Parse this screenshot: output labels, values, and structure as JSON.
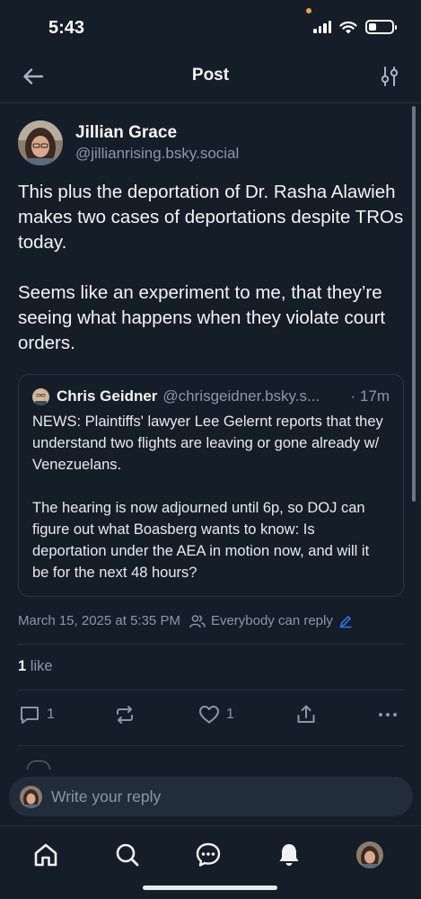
{
  "status_bar": {
    "time": "5:43",
    "battery_level": 0.35
  },
  "header": {
    "title": "Post",
    "back_icon": "arrow-left-icon",
    "filter_icon": "sliders-icon"
  },
  "post": {
    "author_name": "Jillian Grace",
    "author_handle": "@jillianrising.bsky.social",
    "body": "This plus the deportation of Dr. Rasha Alawieh makes two cases of deportations despite TROs today.\n\nSeems like an experiment to me, that they’re seeing what happens when they violate court orders.",
    "quote": {
      "name": "Chris Geidner",
      "handle": "@chrisgeidner.bsky.s...",
      "time": "· 17m",
      "body": "NEWS: Plaintiffs' lawyer Lee Gelernt reports that they understand two flights are leaving or gone already w/ Venezuelans.\n\nThe hearing is now adjourned until 6p, so DOJ can figure out what Boasberg wants to know: Is deportation under the AEA in motion now, and will it be for the next 48 hours?"
    },
    "timestamp": "March 15, 2025 at 5:35 PM",
    "reply_permission": "Everybody can reply",
    "like_count": "1",
    "like_label": "like",
    "actions": {
      "reply_count": "1",
      "like_count": "1"
    }
  },
  "composer": {
    "placeholder": "Write your reply"
  },
  "tabs": [
    "home-icon",
    "search-icon",
    "chat-icon",
    "bell-icon",
    "profile-avatar"
  ],
  "colors": {
    "background": "#151d28",
    "muted": "#8c97a6",
    "accent": "#2f7cf6"
  }
}
